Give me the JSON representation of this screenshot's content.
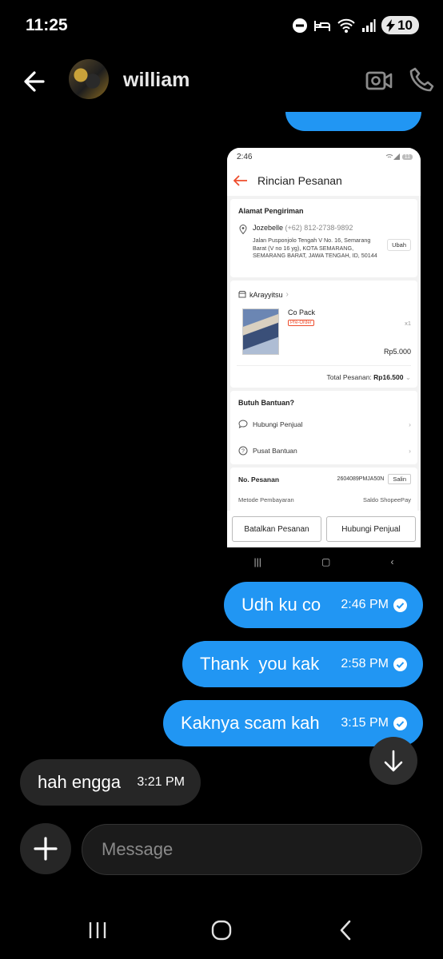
{
  "status_bar": {
    "time": "11:25",
    "battery": "10"
  },
  "header": {
    "contact_name": "william"
  },
  "shared_screenshot": {
    "time": "2:46",
    "battery": "11",
    "title": "Rincian Pesanan",
    "address_section": {
      "heading": "Alamat Pengiriman",
      "recipient": "Jozebelle",
      "phone": "(+62) 812-2738-9892",
      "address": "Jalan Pusponjolo Tengah V No. 16, Semarang Barat (V  no 16 yg), KOTA SEMARANG, SEMARANG BARAT, JAWA TENGAH, ID, 50144",
      "edit_label": "Ubah"
    },
    "shop": {
      "name": "kArayyitsu",
      "product": "Co Pack",
      "badge": "Pre-Order",
      "qty": "x1",
      "price": "Rp5.000",
      "total_label": "Total Pesanan:",
      "total_value": "Rp16.500"
    },
    "help": {
      "heading": "Butuh Bantuan?",
      "contact_seller": "Hubungi Penjual",
      "help_center": "Pusat Bantuan"
    },
    "order": {
      "heading": "No. Pesanan",
      "number": "2604089PMJA50N",
      "copy_label": "Salin",
      "payment_label": "Metode Pembayaran",
      "payment_value": "Saldo ShopeePay"
    },
    "buttons": {
      "cancel": "Batalkan Pesanan",
      "contact": "Hubungi Penjual"
    }
  },
  "messages": [
    {
      "text": "Udh ku co",
      "time": "2:46 PM",
      "direction": "out"
    },
    {
      "text": "Thank  you kak",
      "time": "2:58 PM",
      "direction": "out"
    },
    {
      "text": "Kaknya scam kah",
      "time": "3:15 PM",
      "direction": "out"
    },
    {
      "text": "hah engga",
      "time": "3:21 PM",
      "direction": "in"
    }
  ],
  "composer": {
    "placeholder": "Message"
  },
  "colors": {
    "outgoing_bubble": "#2196f3",
    "incoming_bubble": "#262626",
    "background": "#000000",
    "shopee_accent": "#ee4d2d"
  },
  "icons": [
    "back-arrow-icon",
    "video-call-icon",
    "phone-icon",
    "read-check-icon",
    "scroll-down-icon",
    "add-icon",
    "recents-icon",
    "home-icon",
    "nav-back-icon"
  ]
}
